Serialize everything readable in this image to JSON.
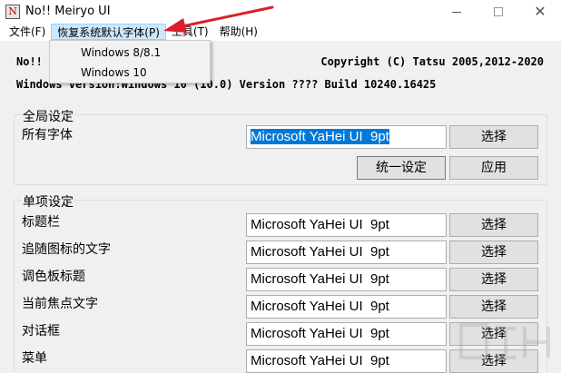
{
  "window": {
    "title": "No!! Meiryo UI",
    "icon": "app-icon",
    "icon_glyph": "N",
    "controls": {
      "minimize": "—",
      "maximize": "□",
      "close": "✕"
    }
  },
  "menu": {
    "items": [
      {
        "label": "文件(F)"
      },
      {
        "label": "恢复系统默认字体(P)"
      },
      {
        "label": "工具(T)"
      },
      {
        "label": "帮助(H)"
      }
    ],
    "dropdown": [
      "Windows 8/8.1",
      "Windows 10"
    ]
  },
  "info": {
    "app": "No!!",
    "copyright": "Copyright (C) Tatsu 2005,2012-2020",
    "version": "Windows Version:Windows 10 (10.0) Version ???? Build 10240.16425"
  },
  "global": {
    "title": "全局设定",
    "all_fonts_label": "所有字体",
    "all_fonts_value": "Microsoft YaHei UI  9pt",
    "select_label": "选择",
    "unify_label": "统一设定",
    "apply_label": "应用"
  },
  "single": {
    "title": "单项设定",
    "rows": [
      {
        "label": "标题栏",
        "value": "Microsoft YaHei UI  9pt",
        "button": "选择"
      },
      {
        "label": "追随图标的文字",
        "value": "Microsoft YaHei UI  9pt",
        "button": "选择"
      },
      {
        "label": "调色板标题",
        "value": "Microsoft YaHei UI  9pt",
        "button": "选择"
      },
      {
        "label": "当前焦点文字",
        "value": "Microsoft YaHei UI  9pt",
        "button": "选择"
      },
      {
        "label": "对话框",
        "value": "Microsoft YaHei UI  9pt",
        "button": "选择"
      },
      {
        "label": "菜单",
        "value": "Microsoft YaHei UI  9pt",
        "button": "选择"
      }
    ]
  },
  "colors": {
    "selection": "#0078d7",
    "menu_highlight": "#cce8ff",
    "annotation_arrow": "#d9202a"
  }
}
